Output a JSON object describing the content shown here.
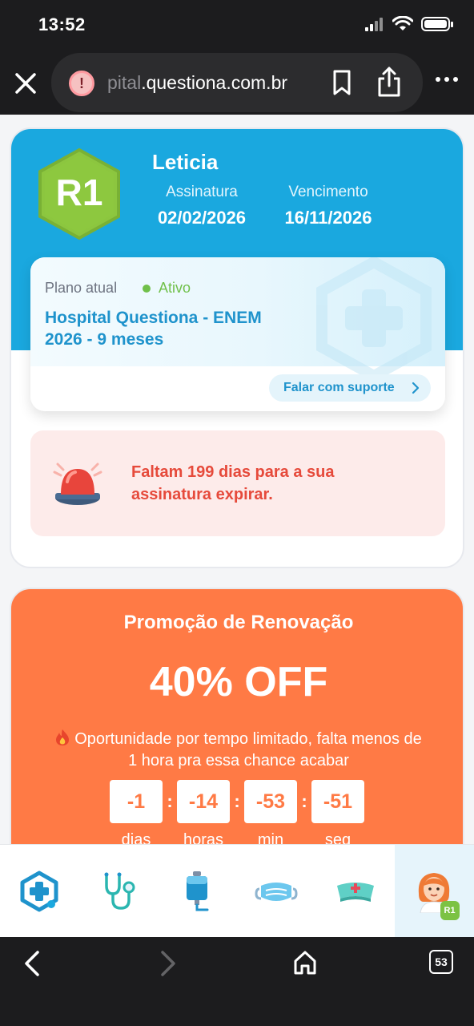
{
  "status_bar": {
    "time": "13:52"
  },
  "browser": {
    "url_faded": "pital",
    "url_main": ".questiona.com.br",
    "tab_count": "53"
  },
  "profile": {
    "badge": "R1",
    "name": "Leticia",
    "subscription_label": "Assinatura",
    "subscription_date": "02/02/2026",
    "expiry_label": "Vencimento",
    "expiry_date": "16/11/2026"
  },
  "plan": {
    "label": "Plano atual",
    "status": "Ativo",
    "name": "Hospital Questiona - ENEM 2026 - 9 meses",
    "support_button": "Falar com suporte"
  },
  "alert": {
    "text": "Faltam 199 dias para a sua assinatura expirar."
  },
  "promo": {
    "title": "Promoção de Renovação",
    "discount": "40% OFF",
    "message": "Oportunidade por tempo limitado, falta menos de 1 hora pra essa chance acabar",
    "countdown": [
      {
        "value": "-1",
        "label": "dias"
      },
      {
        "value": "-14",
        "label": "horas"
      },
      {
        "value": "-53",
        "label": "min"
      },
      {
        "value": "-51",
        "label": "seg"
      }
    ]
  },
  "nav": {
    "items": [
      "home-icon",
      "stethoscope-icon",
      "iv-bag-icon",
      "mask-icon",
      "nurse-cap-icon",
      "avatar-icon"
    ],
    "avatar_badge": "R1",
    "active_index": 5
  },
  "colors": {
    "primary_blue": "#1aa8df",
    "promo_orange": "#ff7a45",
    "alert_red": "#e64a3b",
    "active_green": "#70c04a"
  }
}
